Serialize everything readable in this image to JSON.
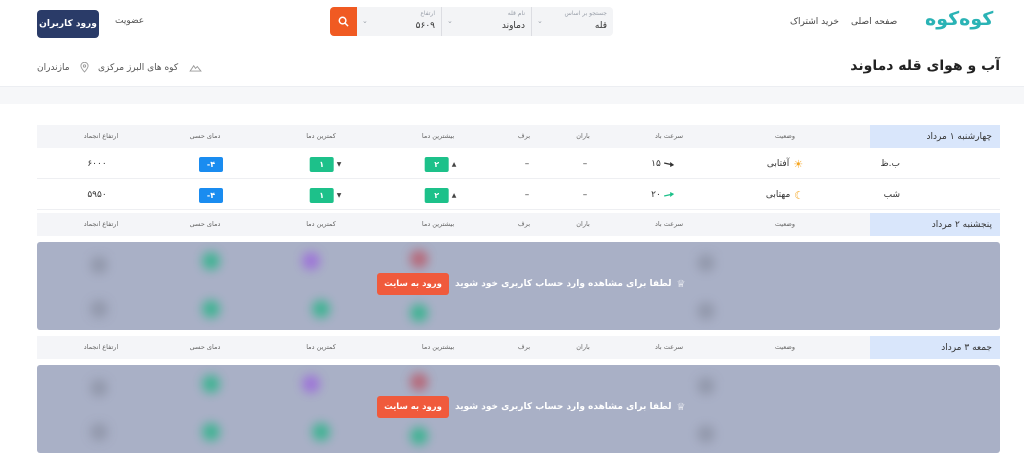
{
  "header": {
    "logo": "کوه‌کوه",
    "nav_home": "صفحه اصلی",
    "nav_subscription": "خرید اشتراک",
    "register": "عضویت",
    "login": "ورود کاربران",
    "search": {
      "field1_label": "جستجو بر اساس",
      "field1_value": "قله",
      "field2_label": "نام قله",
      "field2_value": "دماوند",
      "field3_label": "ارتفاع",
      "field3_value": "۵۶۰۹"
    }
  },
  "page": {
    "title": "آب و هوای قله دماوند",
    "range": "کوه های البرز مرکزی",
    "region": "مازندران"
  },
  "columns": {
    "status": "وضعیت",
    "wind": "سرعت باد",
    "rain": "باران",
    "snow": "برف",
    "max_temp": "بیشترین دما",
    "min_temp": "کمترین دما",
    "feels": "دمای حسی",
    "freeze": "ارتفاع انجماد"
  },
  "days": [
    {
      "label": "چهارشنبه ۱ مرداد",
      "rows": [
        {
          "period": "ب.ظ",
          "status": "آفتابی",
          "wind": "۱۵",
          "rain": "–",
          "snow": "–",
          "max_temp": "۲",
          "min_temp": "۱",
          "feels": "-۴",
          "freeze": "۶۰۰۰"
        },
        {
          "period": "شب",
          "status": "مهتابی",
          "wind": "۲۰",
          "rain": "–",
          "snow": "–",
          "max_temp": "۲",
          "min_temp": "۱",
          "feels": "-۴",
          "freeze": "۵۹۵۰"
        }
      ]
    },
    {
      "label": "پنجشنبه ۲ مرداد"
    },
    {
      "label": "جمعه ۳ مرداد"
    }
  ],
  "locked": {
    "message": "لطفا برای مشاهده وارد حساب کاربری خود شوید",
    "button": "ورود به سایت"
  },
  "colors": {
    "accent": "#f05a22",
    "login_button": "#2a3b68",
    "temp_green": "#1dc18a",
    "temp_blue": "#1a8cf0",
    "day_label_bg": "#d9e6fb",
    "locked_overlay": "#a9b0c6"
  }
}
